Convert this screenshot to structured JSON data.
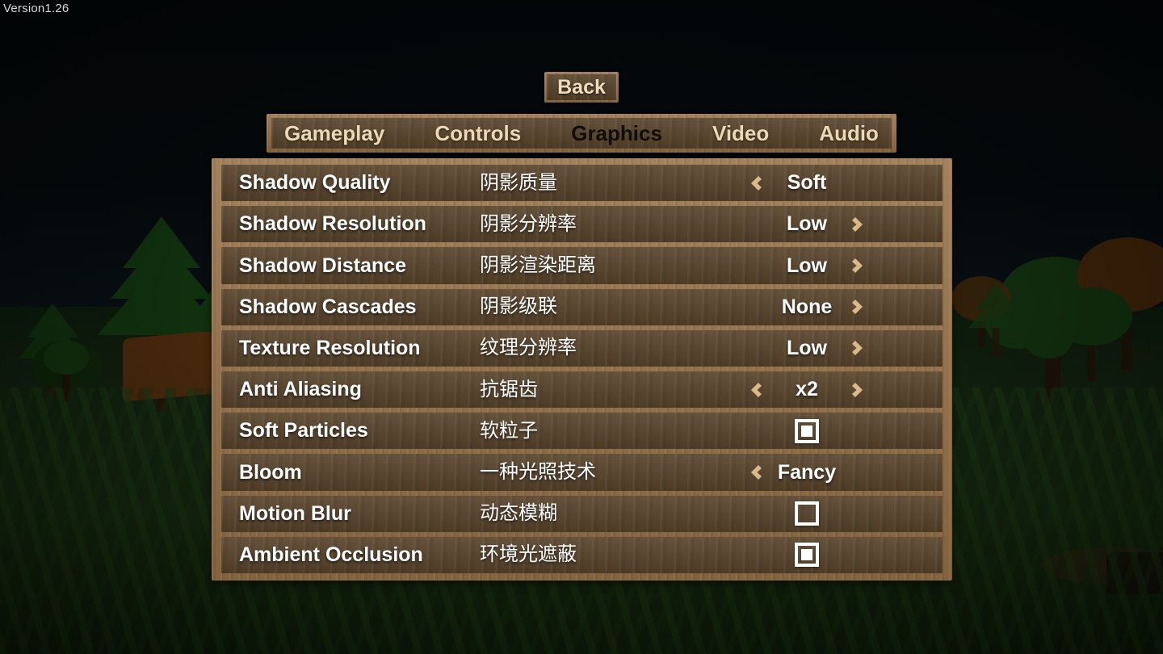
{
  "version_label": "Version1.26",
  "back_button": {
    "label": "Back"
  },
  "tabs": [
    {
      "label": "Gameplay",
      "active": false
    },
    {
      "label": "Controls",
      "active": false
    },
    {
      "label": "Graphics",
      "active": true
    },
    {
      "label": "Video",
      "active": false
    },
    {
      "label": "Audio",
      "active": false
    }
  ],
  "settings": [
    {
      "en": "Shadow Quality",
      "zh": "阴影质量",
      "type": "stepper",
      "value": "Soft",
      "left_arrow": true,
      "right_arrow": false
    },
    {
      "en": "Shadow Resolution",
      "zh": "阴影分辨率",
      "type": "stepper",
      "value": "Low",
      "left_arrow": false,
      "right_arrow": true
    },
    {
      "en": "Shadow Distance",
      "zh": "阴影渲染距离",
      "type": "stepper",
      "value": "Low",
      "left_arrow": false,
      "right_arrow": true
    },
    {
      "en": "Shadow Cascades",
      "zh": "阴影级联",
      "type": "stepper",
      "value": "None",
      "left_arrow": false,
      "right_arrow": true
    },
    {
      "en": "Texture Resolution",
      "zh": "纹理分辨率",
      "type": "stepper",
      "value": "Low",
      "left_arrow": false,
      "right_arrow": true
    },
    {
      "en": "Anti Aliasing",
      "zh": "抗锯齿",
      "type": "stepper",
      "value": "x2",
      "left_arrow": true,
      "right_arrow": true
    },
    {
      "en": "Soft Particles",
      "zh": "软粒子",
      "type": "checkbox",
      "checked": true
    },
    {
      "en": "Bloom",
      "zh": "一种光照技术",
      "type": "stepper",
      "value": "Fancy",
      "left_arrow": true,
      "right_arrow": false
    },
    {
      "en": "Motion Blur",
      "zh": "动态模糊",
      "type": "checkbox",
      "checked": false
    },
    {
      "en": "Ambient Occlusion",
      "zh": "环境光遮蔽",
      "type": "checkbox",
      "checked": true
    }
  ],
  "icons": {
    "chevron_left": "chevron-left-icon",
    "chevron_right": "chevron-right-icon",
    "checkbox_on": "checkbox-checked-icon",
    "checkbox_off": "checkbox-unchecked-icon"
  },
  "colors": {
    "wood_frame": "#997349",
    "wood_row": "#5b462d",
    "text_primary": "#ffffff",
    "text_tab": "#edd8b6",
    "text_tab_active": "#100c06",
    "chevron": "#d9b98a",
    "sky": "#05090a",
    "grass": "#16290f"
  }
}
